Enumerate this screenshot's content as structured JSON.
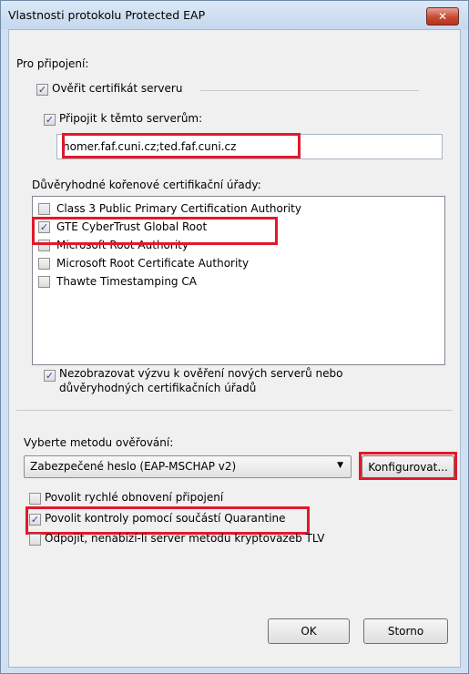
{
  "window": {
    "title": "Vlastnosti protokolu Protected EAP"
  },
  "connection": {
    "heading": "Pro připojení:",
    "verify_cert": {
      "label": "Ověřit certifikát serveru",
      "checked": true
    },
    "connect_servers": {
      "label": "Připojit k těmto serverům:",
      "checked": true
    },
    "servers_value": "homer.faf.cuni.cz;ted.faf.cuni.cz",
    "trusted_ca_heading": "Důvěryhodné kořenové certifikační úřady:",
    "ca_list": [
      {
        "label": "Class 3 Public Primary Certification Authority",
        "checked": false
      },
      {
        "label": "GTE CyberTrust Global Root",
        "checked": true
      },
      {
        "label": "Microsoft Root Authority",
        "checked": false
      },
      {
        "label": "Microsoft Root Certificate Authority",
        "checked": false
      },
      {
        "label": "Thawte Timestamping CA",
        "checked": false
      }
    ],
    "no_prompt": {
      "line1": "Nezobrazovat výzvu k ověření nových serverů nebo",
      "line2": "důvěryhodných certifikačních úřadů",
      "checked": true
    }
  },
  "auth": {
    "heading": "Vyberte metodu ověřování:",
    "method_selected": "Zabezpečené heslo (EAP-MSCHAP v2)",
    "configure_label": "Konfigurovat...",
    "fast_reconnect": {
      "label": "Povolit rychlé obnovení připojení",
      "checked": false
    },
    "quarantine": {
      "label": "Povolit kontroly pomocí součástí Quarantine",
      "checked": true
    },
    "disconnect_tlv": {
      "label": "Odpojit, nenabízí-li server metodu kryptovazeb TLV",
      "checked": false
    }
  },
  "buttons": {
    "ok": "OK",
    "cancel": "Storno"
  },
  "icons": {
    "check": "✓",
    "close": "✕",
    "dropdown": "▼"
  },
  "colors": {
    "highlight_box": "#e0192b",
    "check_mark": "#2b4c8c"
  }
}
